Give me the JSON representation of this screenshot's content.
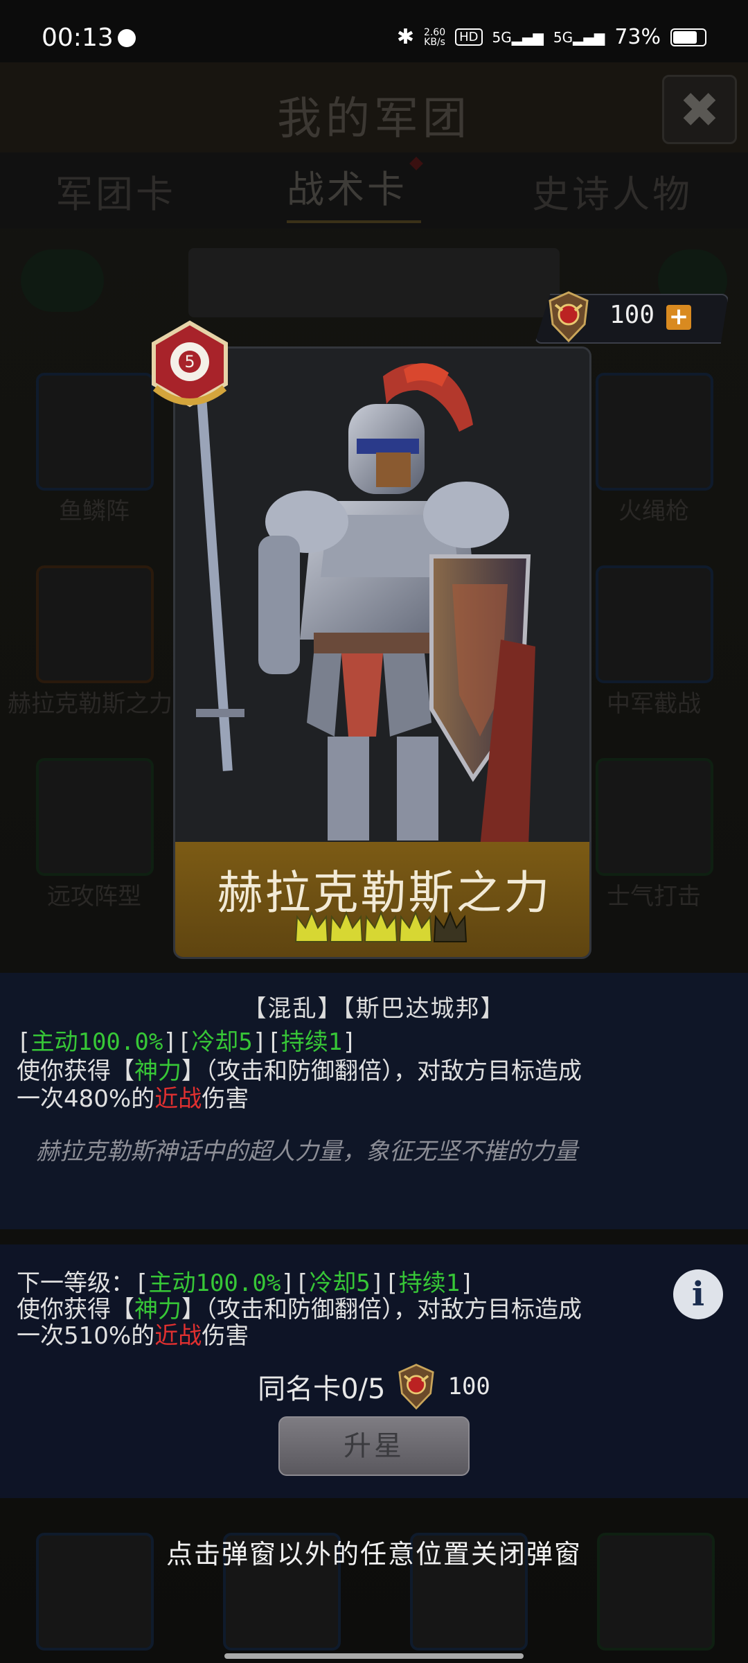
{
  "status_bar": {
    "time": "00:13",
    "net_speed": "2.60",
    "net_unit": "KB/s",
    "hd_label": "HD",
    "sim1": "5G",
    "sim2": "5G",
    "battery": "73%"
  },
  "background": {
    "title": "我的军团",
    "tabs": [
      "军团卡",
      "战术卡",
      "史诗人物"
    ],
    "active_tab": "战术卡",
    "grid_labels": [
      "鱼鳞阵",
      "火绳枪",
      "赫拉克勒斯之力",
      "中军截战",
      "远攻阵型",
      "士气打击"
    ]
  },
  "currency": {
    "amount": "100",
    "plus": "+"
  },
  "card": {
    "name": "赫拉克勒斯之力",
    "stars_total": 5,
    "stars_filled": 4,
    "rank_badge_label": "5"
  },
  "description": {
    "tags": "【混乱】【斯巴达城邦】",
    "stats_line": {
      "open": "[",
      "active": "主动100.0%",
      "mid1": "][",
      "cooldown": "冷却5",
      "mid2": "][",
      "duration": "持续1",
      "close": "]"
    },
    "effect_line1": {
      "pre": "使你获得【",
      "buff": "神力",
      "post": "】（攻击和防御翻倍），对敌方目标造成"
    },
    "effect_line2": {
      "pre": "一次480%的",
      "type": "近战",
      "post": "伤害"
    },
    "flavor": "赫拉克勒斯神话中的超人力量，象征无坚不摧的力量"
  },
  "next_level": {
    "stats_line": {
      "label": "下一等级：[",
      "active": "主动100.0%",
      "mid1": "][",
      "cooldown": "冷却5",
      "mid2": "][",
      "duration": "持续1",
      "close": "]"
    },
    "effect_line1": {
      "pre": "使你获得【",
      "buff": "神力",
      "post": "】（攻击和防御翻倍），对敌方目标造成"
    },
    "effect_line2": {
      "pre": "一次510%的",
      "type": "近战",
      "post": "伤害"
    },
    "info_icon": "i",
    "duplicate_label": "同名卡0/5",
    "duplicate_cost": "100",
    "upgrade_label": "升星"
  },
  "close_hint": "点击弹窗以外的任意位置关闭弹窗",
  "colors": {
    "green_text": "#37c737",
    "red_text": "#e03030",
    "gold_bar": "#7c5b15",
    "panel": "#0f1627"
  }
}
